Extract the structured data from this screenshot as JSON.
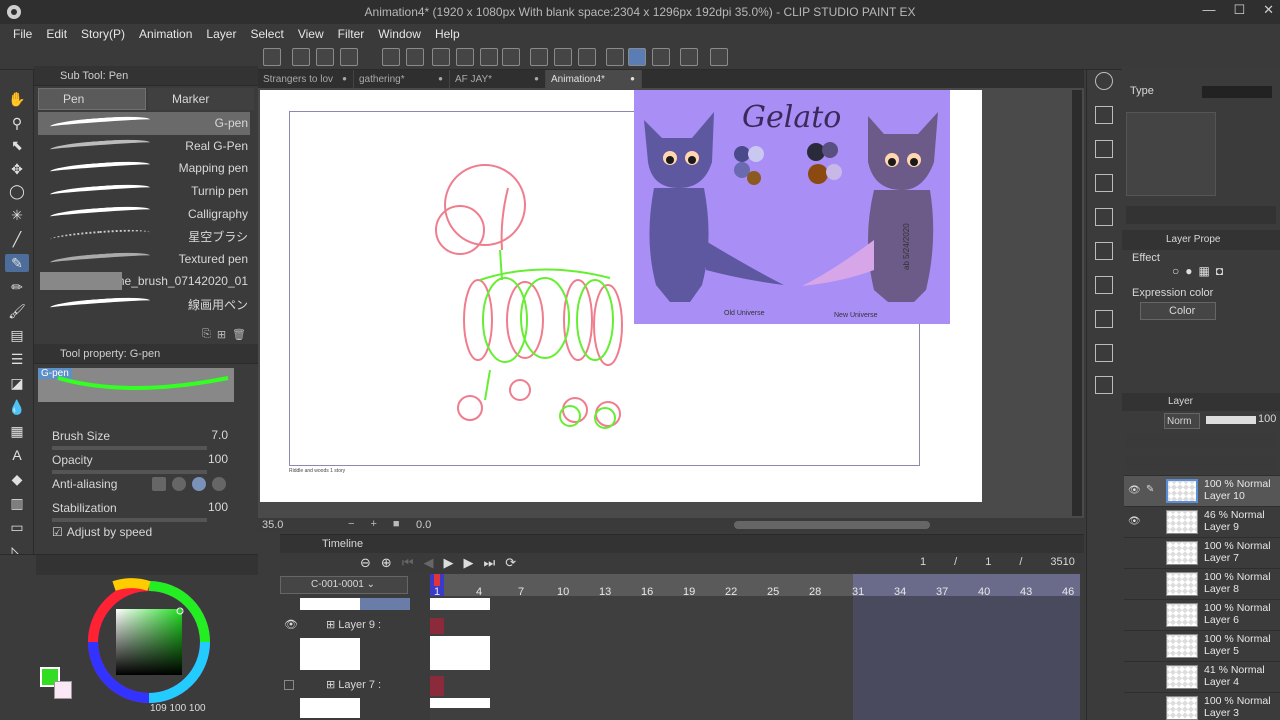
{
  "window": {
    "title": "Animation4* (1920 x 1080px With blank space:2304 x 1296px 192dpi 35.0%)  - CLIP STUDIO PAINT EX",
    "controls": [
      "—",
      "☐",
      "✕"
    ]
  },
  "menu": [
    "File",
    "Edit",
    "Story(P)",
    "Animation",
    "Layer",
    "Select",
    "View",
    "Filter",
    "Window",
    "Help"
  ],
  "doc_tabs": [
    {
      "label": "Strangers to lov",
      "active": false
    },
    {
      "label": "gathering*",
      "active": false
    },
    {
      "label": "AF JAY*",
      "active": false
    },
    {
      "label": "Animation4*",
      "active": true
    }
  ],
  "sub_tool": {
    "header": "Sub Tool: Pen",
    "tabs": [
      "Pen",
      "Marker"
    ],
    "brushes": [
      {
        "name": "G-pen",
        "selected": true
      },
      {
        "name": "Real G-Pen",
        "selected": false
      },
      {
        "name": "Mapping pen",
        "selected": false
      },
      {
        "name": "Turnip pen",
        "selected": false
      },
      {
        "name": "Calligraphy",
        "selected": false
      },
      {
        "name": "星空ブラシ",
        "selected": false
      },
      {
        "name": "Textured pen",
        "selected": false
      },
      {
        "name": "mine_brush_07142020_01",
        "selected": false
      },
      {
        "name": "線画用ペン",
        "selected": false
      }
    ]
  },
  "tool_property": {
    "header": "Tool property: G-pen",
    "preview_label": "G-pen",
    "brush_size_label": "Brush Size",
    "brush_size_value": "7.0",
    "opacity_label": "Opacity",
    "opacity_value": "100",
    "antialiasing_label": "Anti-aliasing",
    "stabilization_label": "Stabilization",
    "stabilization_value": "100",
    "adjust_label": "Adjust by speed"
  },
  "color": {
    "main": "#33dd22",
    "values": "109 100 100"
  },
  "reference": {
    "title": "Gelato",
    "signature": "ab 5/24/2020",
    "caption_left": "Old Universe",
    "caption_right": "New Universe"
  },
  "paper_caption": "Riddle and woods 1 story",
  "status": {
    "zoom": "35.0",
    "rotation": "0.0"
  },
  "timeline": {
    "header": "Timeline",
    "track": "C-001-0001",
    "counters": [
      "1",
      "/",
      "1",
      "/",
      "3510"
    ],
    "frames": [
      "1",
      "4",
      "7",
      "10",
      "13",
      "16",
      "19",
      "22",
      "25",
      "28",
      "31",
      "34",
      "37",
      "40",
      "43",
      "46"
    ],
    "layers": [
      "Layer 9 :",
      "Layer 7 :"
    ]
  },
  "right_panel": {
    "type_label": "Type",
    "layer_prop_header": "Layer Prope",
    "effect_label": "Effect",
    "expression_label": "Expression color",
    "expression_value": "Color",
    "layer_header": "Layer",
    "blend_mode": "Norm",
    "opacity": "100",
    "layers": [
      {
        "line1": "100 % Normal",
        "line2": "Layer 10",
        "visible": true,
        "selected": true
      },
      {
        "line1": "46 % Normal",
        "line2": "Layer 9",
        "visible": true,
        "selected": false
      },
      {
        "line1": "100 % Normal",
        "line2": "Layer 7",
        "visible": false,
        "selected": false
      },
      {
        "line1": "100 % Normal",
        "line2": "Layer 8",
        "visible": false,
        "selected": false
      },
      {
        "line1": "100 % Normal",
        "line2": "Layer 6",
        "visible": false,
        "selected": false
      },
      {
        "line1": "100 % Normal",
        "line2": "Layer 5",
        "visible": false,
        "selected": false
      },
      {
        "line1": "41 % Normal",
        "line2": "Layer 4",
        "visible": false,
        "selected": false
      },
      {
        "line1": "100 % Normal",
        "line2": "Layer 3",
        "visible": false,
        "selected": false
      }
    ]
  }
}
